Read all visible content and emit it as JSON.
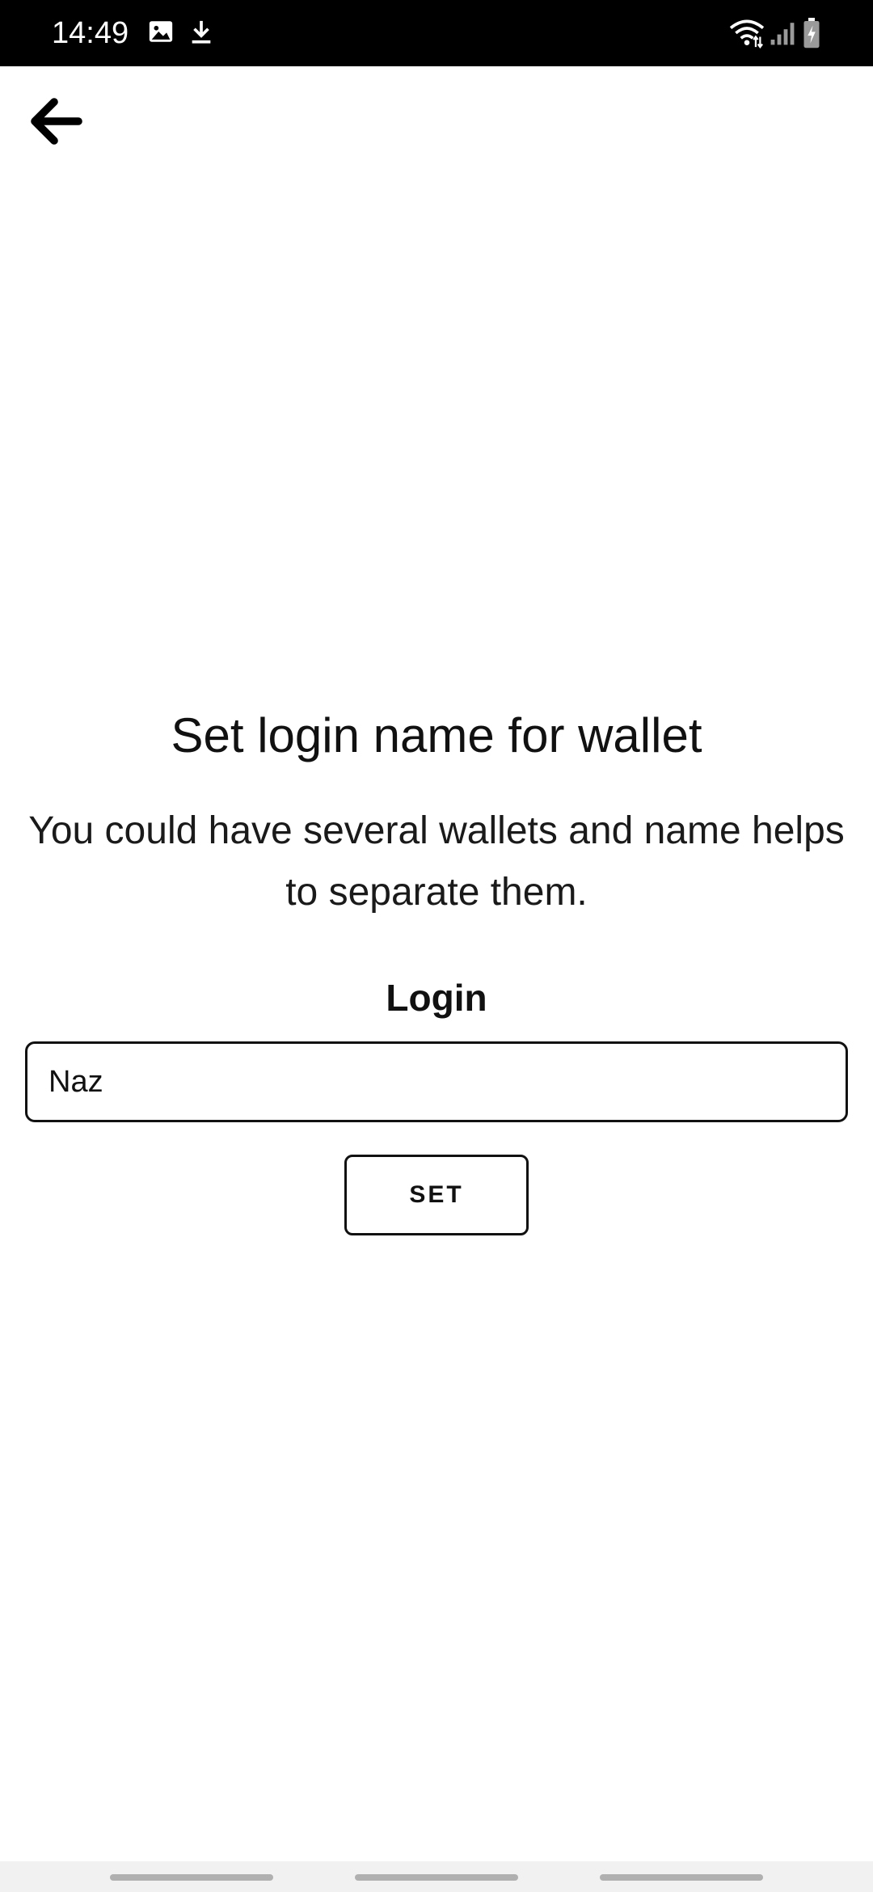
{
  "status_bar": {
    "time": "14:49",
    "icons": [
      "image-icon",
      "download-icon",
      "wifi-icon",
      "signal-icon",
      "battery-icon"
    ]
  },
  "app_bar": {
    "back_icon": "arrow-left-icon"
  },
  "main": {
    "title": "Set login name for wallet",
    "description": "You could have several wallets and name helps to separate them.",
    "login_label": "Login",
    "login_value": "Naz",
    "set_button_label": "SET"
  },
  "colors": {
    "background": "#ffffff",
    "status_bar": "#000000",
    "text": "#111111",
    "nav_bar": "#f1f1f1"
  }
}
